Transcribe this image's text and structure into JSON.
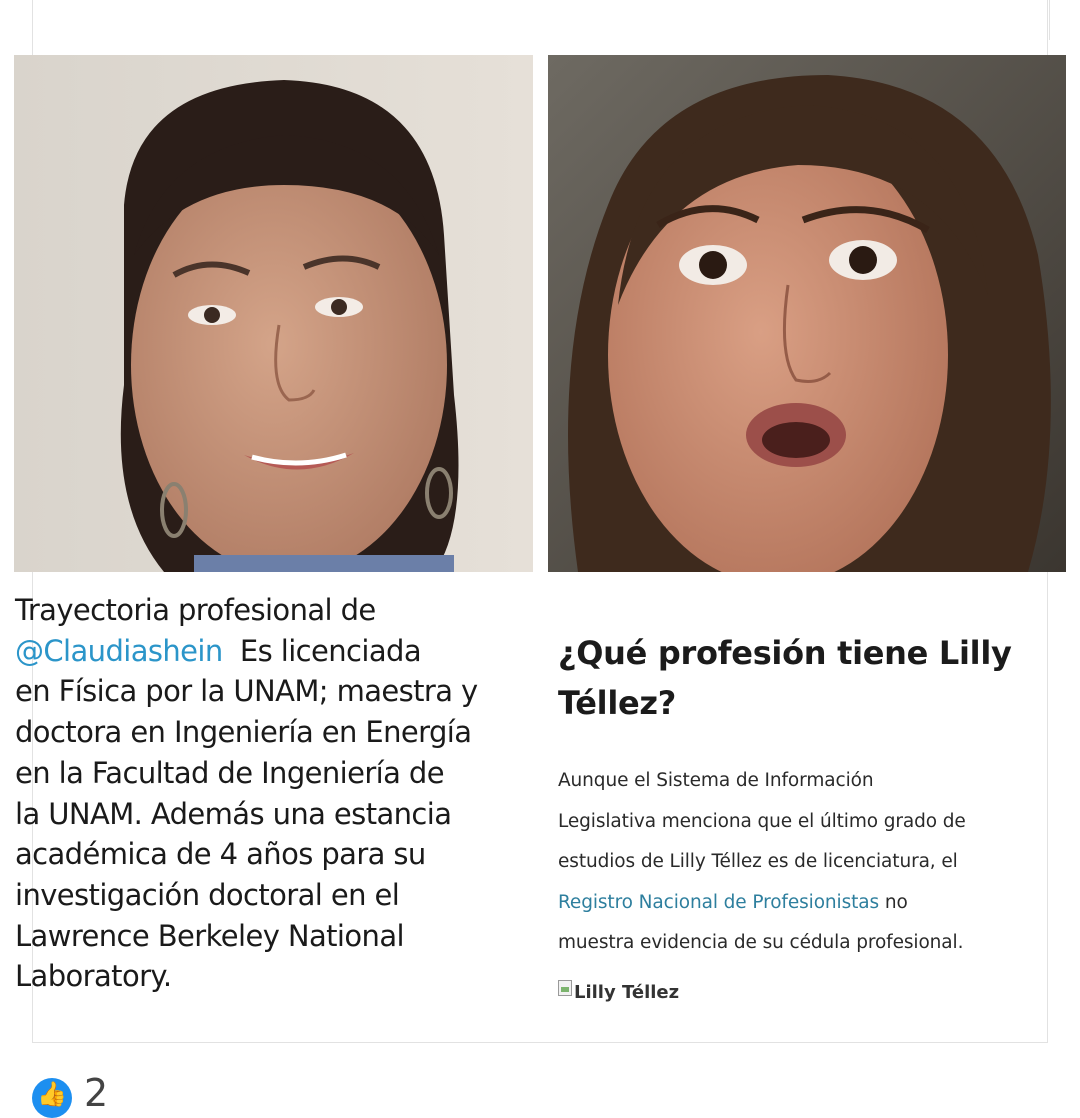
{
  "left": {
    "photo_alt": "Claudia Sheinbaum portrait",
    "caption_line1": "Trayectoria profesional de",
    "mention": "@Claudiashein",
    "caption_rest_line2": "  Es licenciada",
    "caption_lines": [
      "en Física por la UNAM; maestra y",
      "doctora en Ingeniería en Energía",
      "en la Facultad de Ingeniería de",
      "la UNAM. Además una estancia",
      "académica de 4 años para su",
      "investigación doctoral en el",
      "Lawrence Berkeley National",
      "Laboratory."
    ]
  },
  "right": {
    "photo_alt": "Lilly Téllez surprised expression",
    "title_line1": "¿Qué profesión tiene Lilly",
    "title_line2": "Téllez?",
    "body_line1": "Aunque el Sistema de Información",
    "body_line2": "Legislativa menciona que el último grado de",
    "body_line3": "estudios de Lilly Téllez es de licenciatura, el",
    "link_text": "Registro Nacional de Profesionistas",
    "body_after_link": " no",
    "body_line5": "muestra evidencia de su cédula profesional.",
    "broken_image_label": "Lilly Téllez"
  },
  "reactions": {
    "icon": "thumbs-up-icon",
    "count": "2",
    "color": "#1d8ff0"
  }
}
